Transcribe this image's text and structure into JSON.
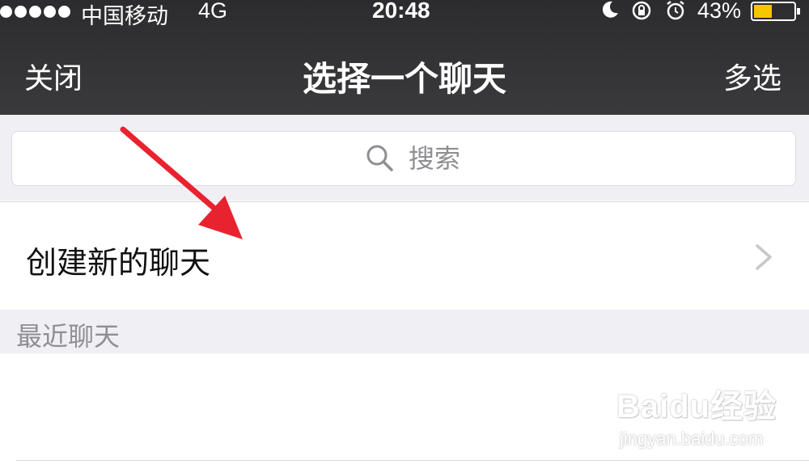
{
  "status_bar": {
    "carrier": "中国移动",
    "network": "4G",
    "time": "20:48",
    "battery": "43%"
  },
  "nav": {
    "close": "关闭",
    "title": "选择一个聊天",
    "multi_select": "多选"
  },
  "search": {
    "placeholder": "搜索"
  },
  "new_chat": {
    "label": "创建新的聊天"
  },
  "recent": {
    "header": "最近聊天"
  },
  "watermark": {
    "main": "Baidu经验",
    "sub": "jingyan.baidu.com"
  },
  "colors": {
    "header_bg": "#333335",
    "group_bg": "#efeff4",
    "arrow": "#e8232f",
    "battery_fill": "#f7c600"
  },
  "icons": [
    "moon-icon",
    "rotation-lock-icon",
    "alarm-icon",
    "battery-icon",
    "search-icon",
    "chevron-right-icon"
  ]
}
